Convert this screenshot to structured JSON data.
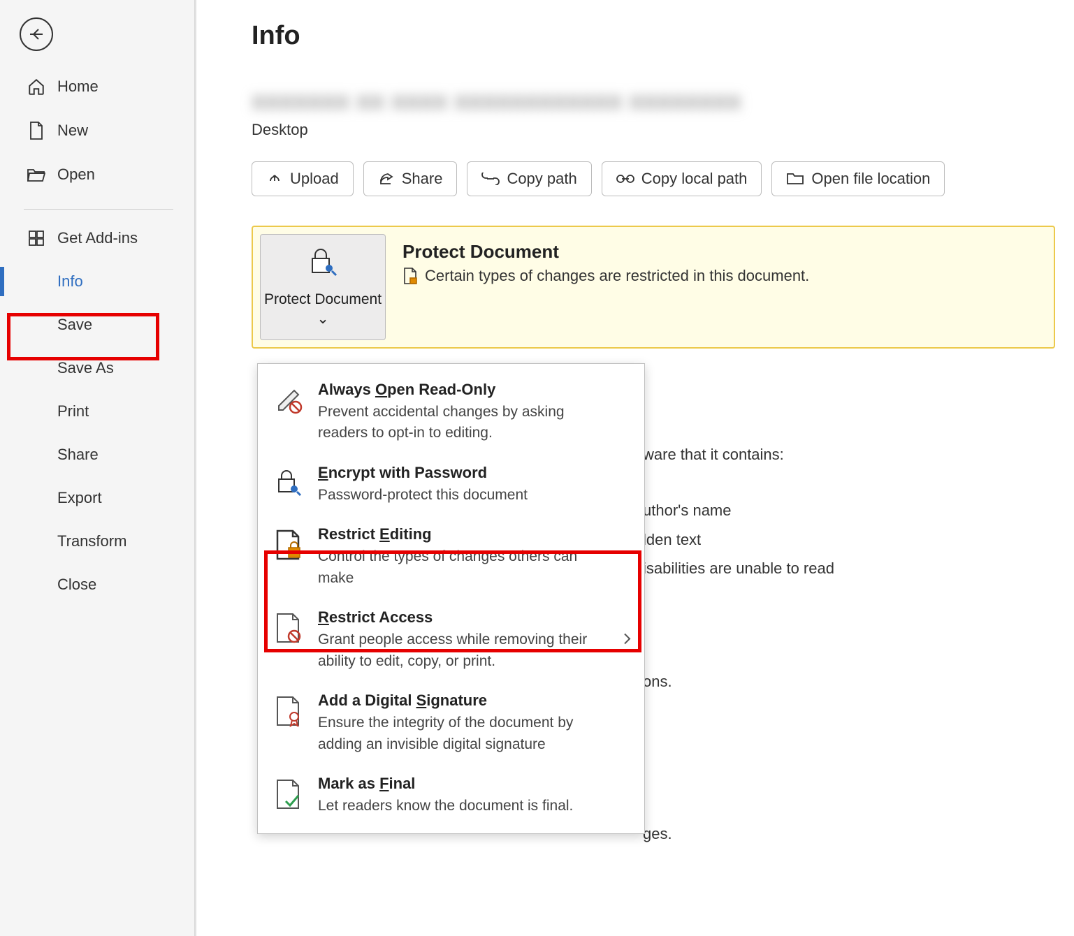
{
  "sidebar": {
    "items_top": [
      {
        "key": "home",
        "label": "Home"
      },
      {
        "key": "new",
        "label": "New"
      },
      {
        "key": "open",
        "label": "Open"
      }
    ],
    "items_bottom": [
      {
        "key": "addins",
        "label": "Get Add-ins",
        "hasIcon": true
      },
      {
        "key": "info",
        "label": "Info",
        "active": true
      },
      {
        "key": "save",
        "label": "Save"
      },
      {
        "key": "saveas",
        "label": "Save As"
      },
      {
        "key": "print",
        "label": "Print"
      },
      {
        "key": "share",
        "label": "Share"
      },
      {
        "key": "export",
        "label": "Export"
      },
      {
        "key": "transform",
        "label": "Transform"
      },
      {
        "key": "close",
        "label": "Close"
      }
    ]
  },
  "page": {
    "title": "Info",
    "docTitleBlurred": "xxxxxxx xx xxxx xxxxxxxxxxxx xxxxxxxx",
    "docLocation": "Desktop"
  },
  "actions": {
    "upload": "Upload",
    "share": "Share",
    "copyPath": "Copy path",
    "copyLocalPath": "Copy local path",
    "openFileLoc": "Open file location"
  },
  "protect": {
    "buttonLabel": "Protect Document",
    "heading": "Protect Document",
    "description": "Certain types of changes are restricted in this document."
  },
  "backgroundLines": {
    "l1": "ware that it contains:",
    "l2": "uthor's name",
    "l3": "lden text",
    "l4": "isabilities are unable to read",
    "l5": "ons.",
    "l6": "ges."
  },
  "dropdown": {
    "items": [
      {
        "key": "readonly",
        "title": "Always Open Read-Only",
        "mnemonic": "O",
        "desc": "Prevent accidental changes by asking readers to opt-in to editing."
      },
      {
        "key": "encrypt",
        "title": "Encrypt with Password",
        "mnemonic": "E",
        "desc": "Password-protect this document"
      },
      {
        "key": "restrict-edit",
        "title": "Restrict Editing",
        "mnemonic": "E",
        "desc": "Control the types of changes others can make"
      },
      {
        "key": "restrict-access",
        "title": "Restrict Access",
        "mnemonic": "R",
        "desc": "Grant people access while removing their ability to edit, copy, or print.",
        "submenu": true
      },
      {
        "key": "digital-sig",
        "title": "Add a Digital Signature",
        "mnemonic": "S",
        "desc": "Ensure the integrity of the document by adding an invisible digital signature"
      },
      {
        "key": "final",
        "title": "Mark as Final",
        "mnemonic": "F",
        "desc": "Let readers know the document is final."
      }
    ]
  }
}
